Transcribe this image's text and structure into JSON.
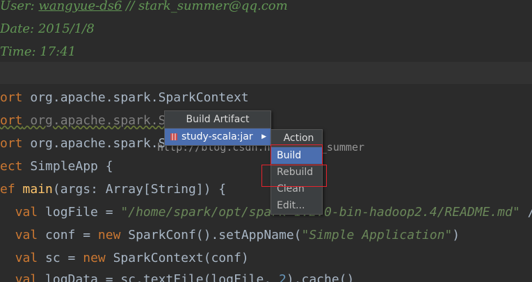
{
  "code": {
    "comment_user_prefix": "User: ",
    "comment_user_name": "wangyue-ds6",
    "comment_user_suffix": " // stark_summer@qq.com",
    "comment_date": "Date: 2015/1/8",
    "comment_time": "Time: 17:41",
    "import1_kw": "ort",
    "import1_path": " org.apache.spark.SparkContext",
    "import2_kw": "ort",
    "import2_path": " org.apache.spark.S",
    "import3_kw": "ort",
    "import3_path": " org.apache.spark.S",
    "object_kw": "ect",
    "object_name": " SimpleApp {",
    "def_kw": "ef",
    "def_name": "main",
    "def_sig": "(args: Array[String]) {",
    "val1_kw": "val",
    "val1_text": " logFile = ",
    "val1_str": "\"/home/spark/opt/spark-1.2.0-bin-hadoop2.4/README.md\"",
    "val1_tail": " /",
    "val2_kw": "val",
    "val2_text": " conf = ",
    "val2_new": "new",
    "val2_call": " SparkConf().setAppName(",
    "val2_str": "\"Simple Application\"",
    "val2_end": ")",
    "val3_kw": "val",
    "val3_text": " sc = ",
    "val3_new": "new",
    "val3_call": " SparkContext(conf)",
    "val4_kw": "val",
    "val4_text": " logData = sc.textFile(logFile, ",
    "val4_num": "2",
    "val4_end": ").cache()"
  },
  "build_artifact_menu": {
    "title": "Build Artifact",
    "item": "study-scala:jar",
    "arrow": "▶"
  },
  "action_menu": {
    "title": "Action",
    "items": [
      "Build",
      "Rebuild",
      "Clean",
      "Edit..."
    ]
  },
  "watermark": "http://blog.csdn.net/stark_summer",
  "colors": {
    "background": "#2b2b2b",
    "comment": "#629755",
    "keyword": "#cc7832",
    "selection": "#4b6eaf",
    "highlight_box": "#e8232d"
  }
}
